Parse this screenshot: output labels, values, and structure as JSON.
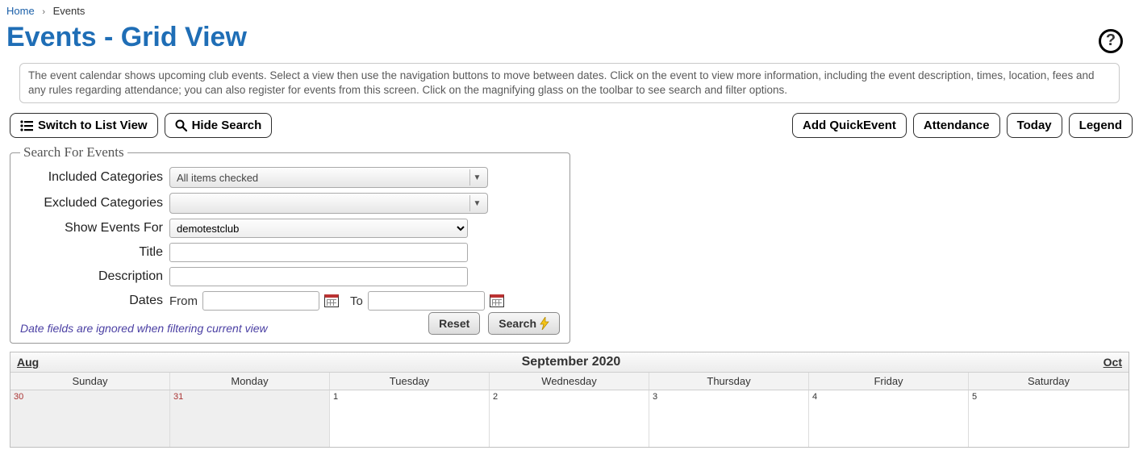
{
  "breadcrumb": {
    "home": "Home",
    "current": "Events"
  },
  "page_title": "Events - Grid View",
  "help_tooltip": "?",
  "info_text": "The event calendar shows upcoming club events. Select a view then use the navigation buttons to move between dates. Click on the event to view more information, including the event description, times, location, fees and any rules regarding attendance; you can also register for events from this screen. Click on the magnifying glass on the toolbar to see search and filter options.",
  "toolbar": {
    "switch_view": "Switch to List View",
    "hide_search": "Hide Search",
    "add_quickevent": "Add QuickEvent",
    "attendance": "Attendance",
    "today": "Today",
    "legend": "Legend"
  },
  "search": {
    "legend": "Search For Events",
    "included_label": "Included Categories",
    "included_value": "All items checked",
    "excluded_label": "Excluded Categories",
    "excluded_value": "",
    "show_for_label": "Show Events For",
    "show_for_value": "demotestclub",
    "title_label": "Title",
    "title_value": "",
    "description_label": "Description",
    "description_value": "",
    "dates_label": "Dates",
    "from_label": "From",
    "from_value": "",
    "to_label": "To",
    "to_value": "",
    "note": "Date fields are ignored when filtering current view",
    "reset": "Reset",
    "search_btn": "Search"
  },
  "calendar": {
    "prev_month": "Aug",
    "current_month": "September 2020",
    "next_month": "Oct",
    "day_headers": [
      "Sunday",
      "Monday",
      "Tuesday",
      "Wednesday",
      "Thursday",
      "Friday",
      "Saturday"
    ],
    "week1": [
      {
        "n": "30",
        "other": true
      },
      {
        "n": "31",
        "other": true
      },
      {
        "n": "1",
        "other": false
      },
      {
        "n": "2",
        "other": false
      },
      {
        "n": "3",
        "other": false
      },
      {
        "n": "4",
        "other": false
      },
      {
        "n": "5",
        "other": false
      }
    ]
  }
}
